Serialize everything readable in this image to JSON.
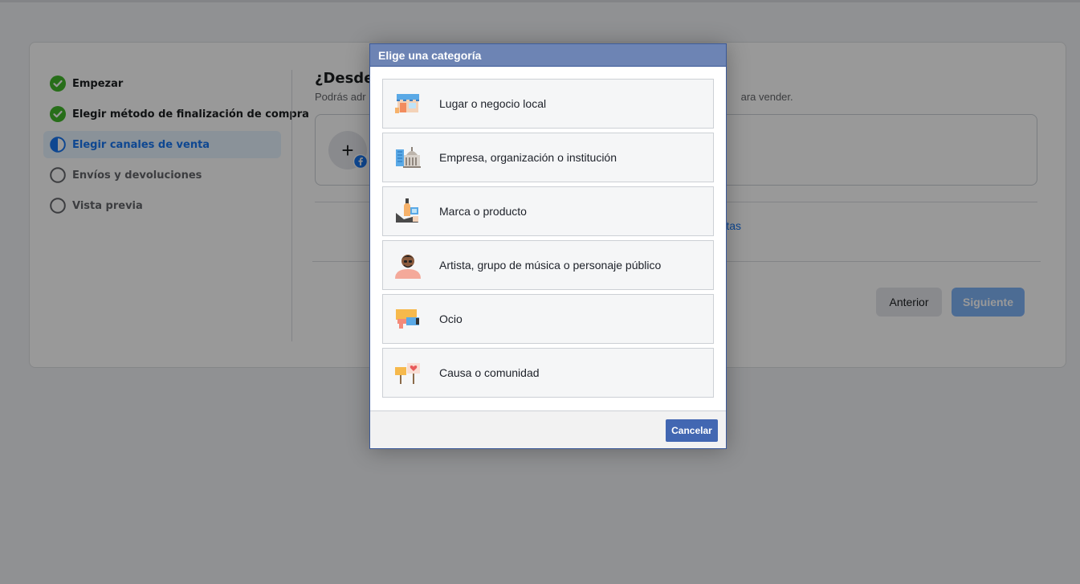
{
  "steps": [
    {
      "label": "Empezar",
      "state": "done"
    },
    {
      "label": "Elegir método de finalización de compra",
      "state": "done"
    },
    {
      "label": "Elegir canales de venta",
      "state": "active"
    },
    {
      "label": "Envíos y devoluciones",
      "state": "pending"
    },
    {
      "label": "Vista previa",
      "state": "pending"
    }
  ],
  "main": {
    "title": "¿Desde",
    "description": "Podrás adr",
    "description_tail": "ara vender.",
    "link_fragment": "tas"
  },
  "buttons": {
    "previous": "Anterior",
    "next": "Siguiente"
  },
  "dialog": {
    "title": "Elige una categoría",
    "categories": [
      {
        "label": "Lugar o negocio local",
        "icon": "local-business-icon"
      },
      {
        "label": "Empresa, organización o institución",
        "icon": "company-icon"
      },
      {
        "label": "Marca o producto",
        "icon": "brand-product-icon"
      },
      {
        "label": "Artista, grupo de música o personaje público",
        "icon": "artist-icon"
      },
      {
        "label": "Ocio",
        "icon": "entertainment-icon"
      },
      {
        "label": "Causa o comunidad",
        "icon": "cause-community-icon"
      }
    ],
    "cancel": "Cancelar"
  },
  "colors": {
    "accent": "#1877f2",
    "success": "#42b72a",
    "dialog_header": "#6d84b4",
    "dialog_button": "#4267b2"
  }
}
